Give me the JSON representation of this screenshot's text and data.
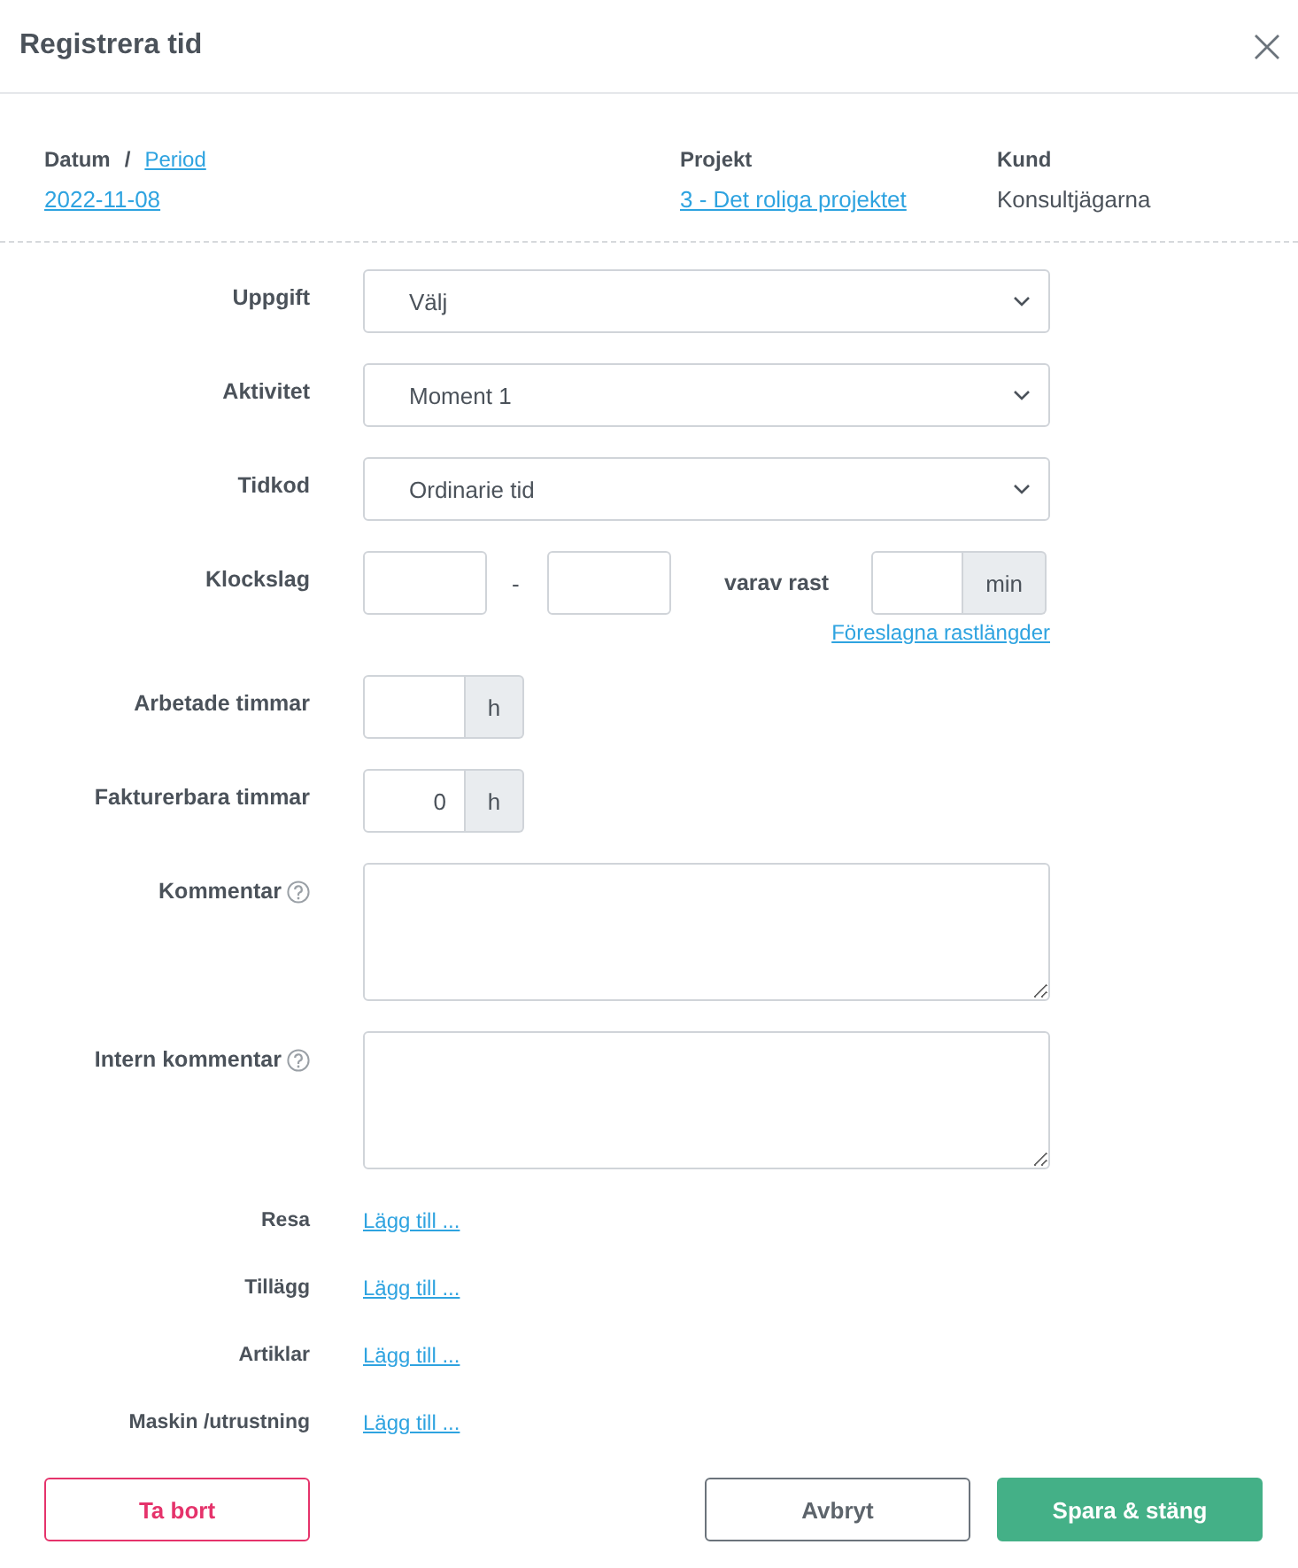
{
  "window": {
    "title": "Registrera tid"
  },
  "info": {
    "date_label": "Datum",
    "separator": "/",
    "period_link": "Period",
    "date": "2022-11-08",
    "project_label": "Projekt",
    "project": "3 - Det roliga projektet",
    "customer_label": "Kund",
    "customer": "Konsultjägarna"
  },
  "fields": [
    {
      "kind": "select",
      "label": "Uppgift",
      "value": "Välj"
    },
    {
      "kind": "select",
      "label": "Aktivitet",
      "value": "Moment 1"
    },
    {
      "kind": "select",
      "label": "Tidkod",
      "value": "Ordinarie tid"
    },
    {
      "kind": "time_range",
      "label": "Klockslag",
      "separator": "-",
      "break_label": "varav rast",
      "break_unit": "min",
      "link": "Föreslagna rastlängder"
    },
    {
      "kind": "unit_input",
      "label": "Arbetade timmar",
      "unit": "h"
    },
    {
      "kind": "unit_input",
      "label": "Fakturerbara timmar",
      "value": "0",
      "unit": "h"
    },
    {
      "kind": "textarea",
      "label": "Kommentar",
      "help": true
    },
    {
      "kind": "textarea",
      "label": "Intern kommentar",
      "help": true
    }
  ],
  "extras": [
    {
      "label": "Resa",
      "link": "Lägg till ..."
    },
    {
      "label": "Tillägg",
      "link": "Lägg till ..."
    },
    {
      "label": "Artiklar",
      "link": "Lägg till ..."
    },
    {
      "label": "Maskin /utrustning",
      "link": "Lägg till ..."
    }
  ],
  "buttons": [
    {
      "kind": "danger",
      "label": "Ta bort"
    },
    {
      "kind": "secondary",
      "label": "Avbryt"
    },
    {
      "kind": "primary",
      "label": "Spara & stäng"
    }
  ]
}
